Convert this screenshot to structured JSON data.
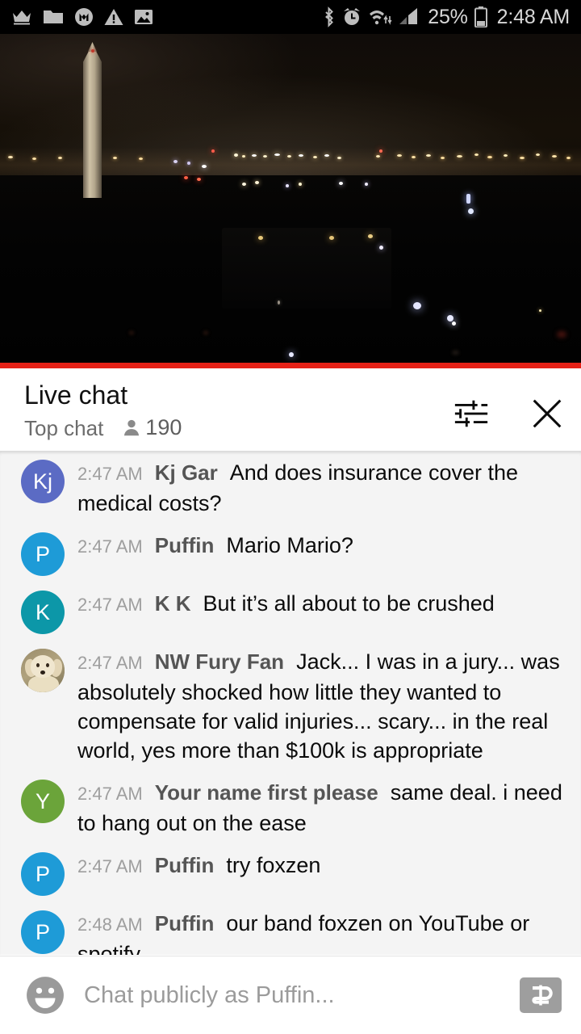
{
  "statusbar": {
    "left_icons": [
      "crown-icon",
      "folder-icon",
      "messenger-m-icon",
      "warning-triangle-icon",
      "image-icon"
    ],
    "right_icons": [
      "bluetooth-icon",
      "alarm-clock-icon",
      "wifi-icon",
      "cell-signal-icon",
      "battery-icon"
    ],
    "battery_percent": "25%",
    "time": "2:48 AM"
  },
  "video": {
    "label": "washington-dc-night-livestream",
    "progress_color": "#e62117"
  },
  "chat_header": {
    "title": "Live chat",
    "mode": "Top chat",
    "viewer_icon": "person-icon",
    "viewer_count": "190",
    "settings_icon": "tune-sliders-icon",
    "close_icon": "close-x-icon"
  },
  "messages": [
    {
      "avatar_type": "initials",
      "avatar_text": "Kj",
      "avatar_color": "#5B6BC4",
      "timestamp": "2:47 AM",
      "author": "Kj Gar",
      "text": "And does insurance cover the medical costs?"
    },
    {
      "avatar_type": "initials",
      "avatar_text": "P",
      "avatar_color": "#1E9BD7",
      "timestamp": "2:47 AM",
      "author": "Puffin",
      "text": "Mario Mario?"
    },
    {
      "avatar_type": "initials",
      "avatar_text": "K",
      "avatar_color": "#0C97A8",
      "timestamp": "2:47 AM",
      "author": "K K",
      "text": "But it’s all about to be crushed"
    },
    {
      "avatar_type": "photo",
      "avatar_text": "",
      "avatar_color": "#8a7f63",
      "timestamp": "2:47 AM",
      "author": "NW Fury Fan",
      "text": "Jack... I was in a jury... was absolutely shocked how little they wanted to compensate for valid injuries... scary... in the real world, yes more than $100k is appropriate"
    },
    {
      "avatar_type": "initials",
      "avatar_text": "Y",
      "avatar_color": "#6BA43A",
      "timestamp": "2:47 AM",
      "author": "Your name first please",
      "text": "same deal. i need to hang out on the ease"
    },
    {
      "avatar_type": "initials",
      "avatar_text": "P",
      "avatar_color": "#1E9BD7",
      "timestamp": "2:47 AM",
      "author": "Puffin",
      "text": "try foxzen"
    },
    {
      "avatar_type": "initials",
      "avatar_text": "P",
      "avatar_color": "#1E9BD7",
      "timestamp": "2:48 AM",
      "author": "Puffin",
      "text": "our band foxzen on YouTube or spotify"
    }
  ],
  "input_bar": {
    "emoji_icon": "emoji-smiley-icon",
    "placeholder": "Chat publicly as Puffin...",
    "value": "",
    "superchat_icon": "dollar-sign-icon"
  }
}
